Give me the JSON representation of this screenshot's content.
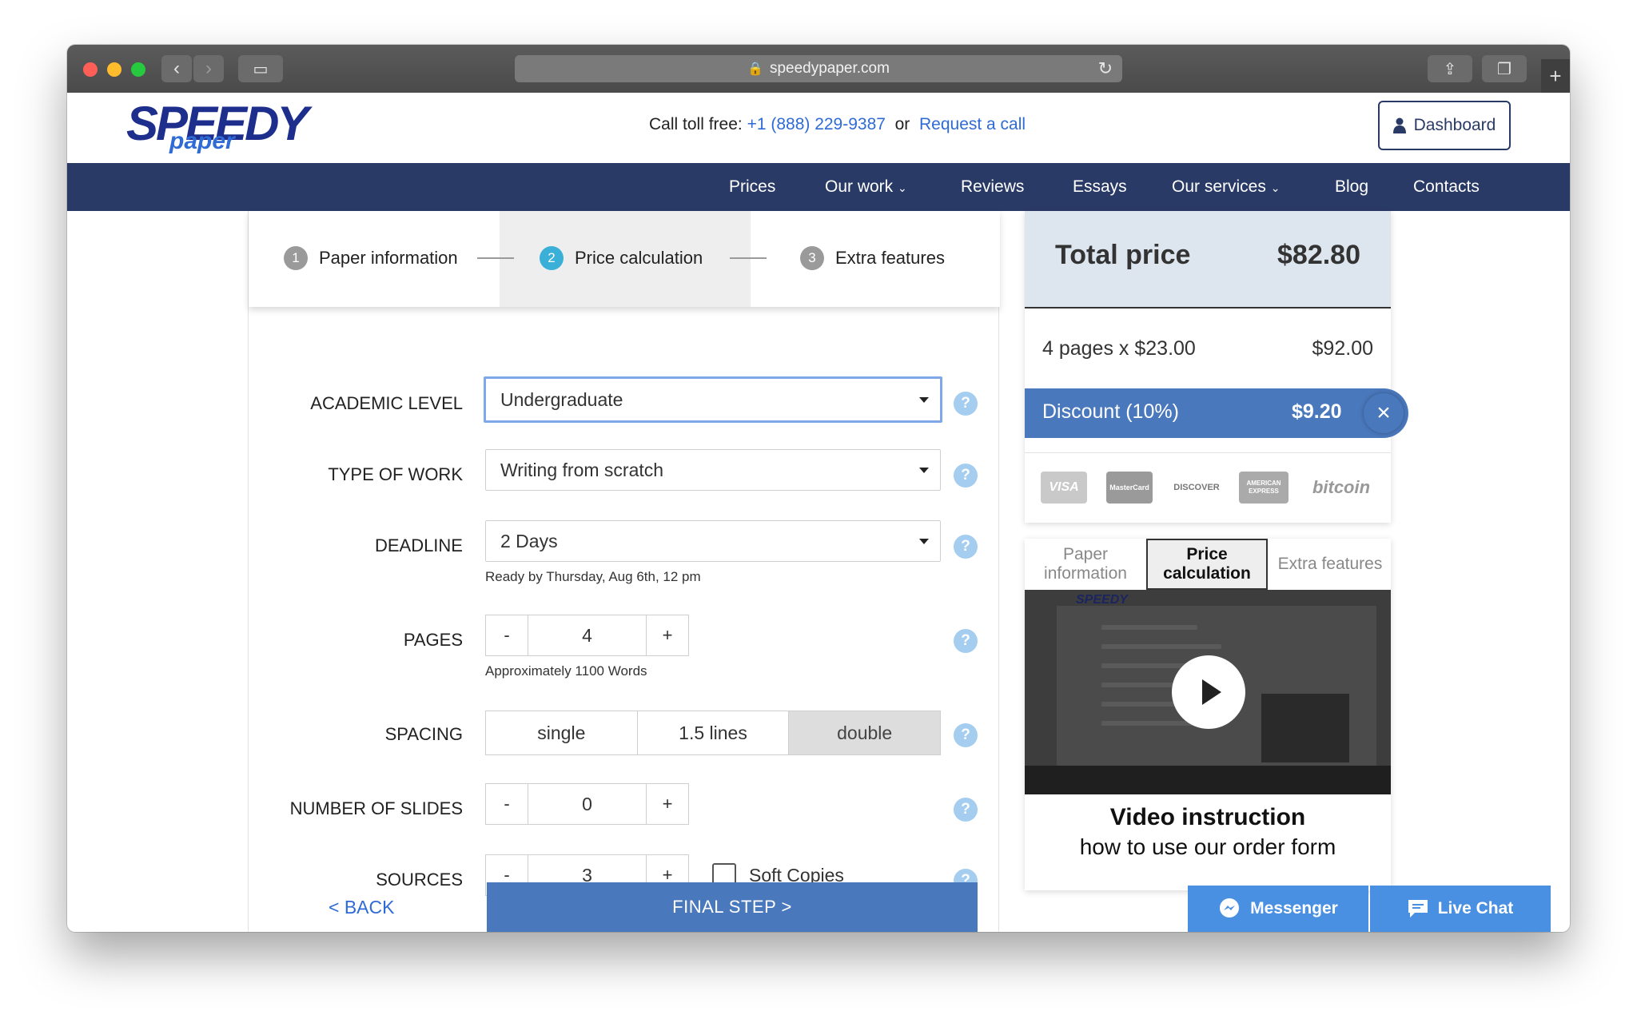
{
  "browser": {
    "url": "speedypaper.com",
    "lock_icon": "lock-icon",
    "colors": {
      "titlebar": "#4a4a4a",
      "close": "#ff5f56",
      "minimize": "#ffbd2e",
      "zoom": "#27c93f"
    }
  },
  "header": {
    "logo_top": "SPEEDY",
    "logo_bottom": "paper",
    "call_label": "Call toll free:",
    "phone": "+1 (888) 229-9387",
    "or": "or",
    "request_call": "Request a call",
    "dashboard_label": "Dashboard"
  },
  "nav": {
    "items": [
      {
        "label": "Prices",
        "has_dropdown": false
      },
      {
        "label": "Our work",
        "has_dropdown": true
      },
      {
        "label": "Reviews",
        "has_dropdown": false
      },
      {
        "label": "Essays",
        "has_dropdown": false
      },
      {
        "label": "Our services",
        "has_dropdown": true
      },
      {
        "label": "Blog",
        "has_dropdown": false
      },
      {
        "label": "Contacts",
        "has_dropdown": false
      }
    ]
  },
  "steps": [
    {
      "num": "1",
      "label": "Paper information"
    },
    {
      "num": "2",
      "label": "Price calculation",
      "active": true
    },
    {
      "num": "3",
      "label": "Extra features"
    }
  ],
  "form": {
    "academic_level": {
      "label": "ACADEMIC LEVEL",
      "value": "Undergraduate"
    },
    "type_of_work": {
      "label": "TYPE OF WORK",
      "value": "Writing from scratch"
    },
    "deadline": {
      "label": "DEADLINE",
      "value": "2 Days",
      "hint": "Ready by Thursday, Aug 6th, 12 pm"
    },
    "pages": {
      "label": "PAGES",
      "value": "4",
      "hint": "Approximately 1100 Words",
      "minus": "-",
      "plus": "+"
    },
    "spacing": {
      "label": "SPACING",
      "options": [
        "single",
        "1.5 lines",
        "double"
      ],
      "selected": "double"
    },
    "slides": {
      "label": "NUMBER OF SLIDES",
      "value": "0",
      "minus": "-",
      "plus": "+"
    },
    "sources": {
      "label": "SOURCES",
      "value": "3",
      "minus": "-",
      "plus": "+",
      "soft_copies": "Soft Copies",
      "soft_copies_checked": false
    },
    "help": "?",
    "back": "< BACK",
    "final": "FINAL STEP >"
  },
  "price": {
    "total_label": "Total price",
    "total_value": "$82.80",
    "line_label": "4 pages x $23.00",
    "line_value": "$92.00",
    "discount_label": "Discount (10%)",
    "discount_value": "$9.20",
    "discount_close": "×",
    "payments": [
      "VISA",
      "MasterCard",
      "DISCOVER",
      "AMERICAN EXPRESS",
      "bitcoin"
    ]
  },
  "video": {
    "tabs": [
      "Paper information",
      "Price calculation",
      "Extra features"
    ],
    "active_tab": "Price calculation",
    "thumb_logo": "SPEEDY",
    "title": "Video instruction",
    "subtitle": "how to use our order form"
  },
  "chat": {
    "messenger": "Messenger",
    "livechat": "Live Chat"
  }
}
